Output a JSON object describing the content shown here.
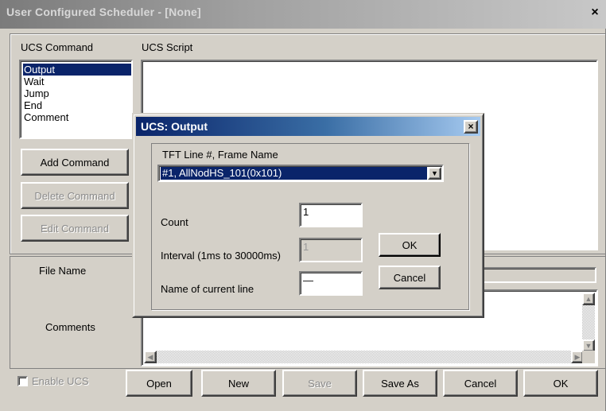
{
  "main_window": {
    "title": "User Configured Scheduler - [None]",
    "close_glyph": "×",
    "ucs_command_label": "UCS Command",
    "ucs_script_label": "UCS Script",
    "commands": [
      "Output",
      "Wait",
      "Jump",
      "End",
      "Comment"
    ],
    "selected_command": "Output",
    "buttons": {
      "add_command": "Add Command",
      "delete_command": "Delete Command",
      "edit_command": "Edit Command"
    },
    "file_name_label": "File Name",
    "comments_label": "Comments",
    "enable_ucs_label": "Enable UCS",
    "bottom_buttons": {
      "open": "Open",
      "new": "New",
      "save": "Save",
      "save_as": "Save As",
      "cancel": "Cancel",
      "ok": "OK"
    }
  },
  "dialog": {
    "title": "UCS: Output",
    "close_glyph": "×",
    "tft_label": "TFT Line #, Frame Name",
    "frame_value": "#1, AllNodHS_101(0x101)",
    "count_label": "Count",
    "count_value": "1",
    "interval_label": "Interval (1ms to 30000ms)",
    "interval_value": "1",
    "name_label": "Name of current line",
    "name_value": "—",
    "ok": "OK",
    "cancel": "Cancel"
  },
  "colors": {
    "dialog_titlebar": "#0a246a",
    "selection": "#0a246a",
    "face": "#d4d0c8"
  }
}
